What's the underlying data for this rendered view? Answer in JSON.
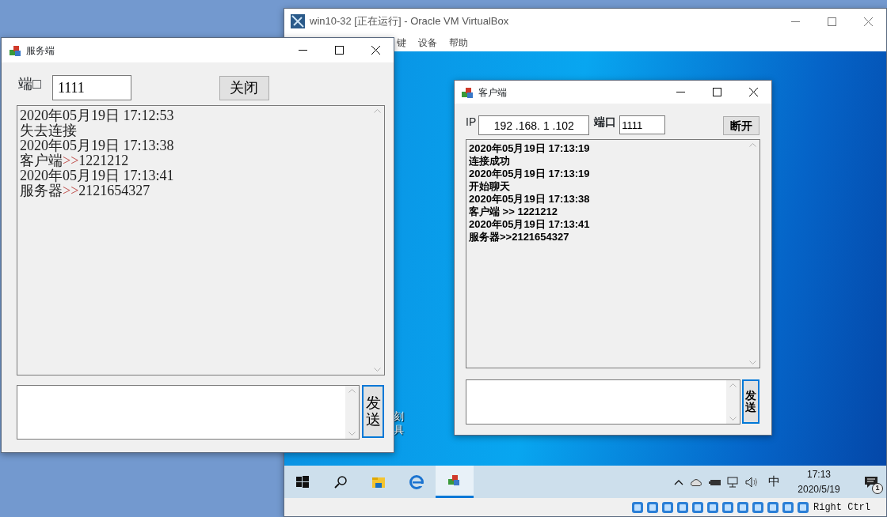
{
  "vm_window": {
    "title": "win10-32 [正在运行] - Oracle VM VirtualBox",
    "menu": [
      "键",
      "设备",
      "帮助"
    ]
  },
  "desktop_icon_label": [
    "刻",
    "具"
  ],
  "server_window": {
    "title": "服务端",
    "port_label": "端□",
    "port_value": "1111",
    "close_button": "关闭",
    "log": [
      {
        "kind": "time",
        "text": "2020年05月19日 17:12:53"
      },
      {
        "kind": "status",
        "text": "失去连接"
      },
      {
        "kind": "time",
        "text": "2020年05月19日 17:13:38"
      },
      {
        "kind": "message",
        "sender": "客户端",
        "separator": ">>",
        "content": "1221212"
      },
      {
        "kind": "time",
        "text": "2020年05月19日 17:13:41"
      },
      {
        "kind": "message",
        "sender": "服务器",
        "separator": ">>",
        "content": "2121654327"
      }
    ],
    "send_button": "发送"
  },
  "client_window": {
    "title": "客户端",
    "ip_label": "IP",
    "ip_value": "192 .168. 1 .102",
    "port_label": "端口",
    "port_value": "1111",
    "disconnect_button": "断开",
    "log": [
      "2020年05月19日 17:13:19",
      "连接成功",
      "2020年05月19日 17:13:19",
      "开始聊天",
      "2020年05月19日 17:13:38",
      "客户端 >> 1221212",
      "2020年05月19日 17:13:41",
      "服务器>>2121654327"
    ],
    "send_button": "发送"
  },
  "taskbar": {
    "apps": [
      {
        "kind": "start",
        "selected": false
      },
      {
        "kind": "search",
        "selected": false
      },
      {
        "kind": "explorer",
        "selected": false
      },
      {
        "kind": "browser",
        "selected": false
      },
      {
        "kind": "app",
        "selected": true
      }
    ],
    "ime": "中",
    "time": "17:13",
    "date": "2020/5/19",
    "notifications": "1"
  },
  "status_bar": {
    "host_key": "Right Ctrl"
  }
}
